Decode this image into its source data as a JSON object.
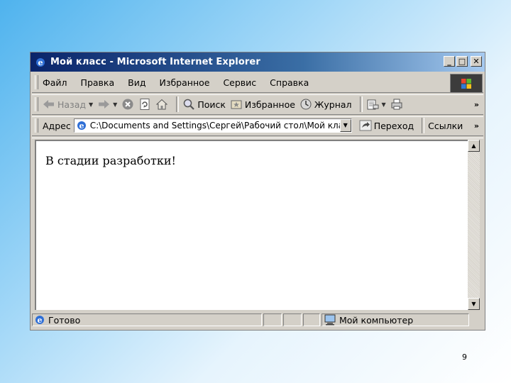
{
  "window": {
    "title": "Мой класс - Microsoft Internet Explorer"
  },
  "menu": {
    "items": [
      "Файл",
      "Правка",
      "Вид",
      "Избранное",
      "Сервис",
      "Справка"
    ]
  },
  "toolbar": {
    "back_label": "Назад",
    "search_label": "Поиск",
    "favorites_label": "Избранное",
    "history_label": "Журнал"
  },
  "address": {
    "label": "Адрес",
    "value": "C:\\Documents and Settings\\Сергей\\Рабочий стол\\Мой класс",
    "go_label": "Переход",
    "links_label": "Ссылки"
  },
  "page": {
    "text": "В стадии разработки!"
  },
  "status": {
    "text": "Готово",
    "zone": "Мой компьютер"
  },
  "slide": {
    "page_number": "9"
  },
  "colors": {
    "titlebar_start": "#0a246a",
    "titlebar_end": "#a6caf0",
    "chrome": "#d4d0c8"
  },
  "icons": [
    "ie-icon",
    "back-arrow-icon",
    "forward-arrow-icon",
    "stop-icon",
    "refresh-icon",
    "home-icon",
    "search-icon",
    "favorites-icon",
    "history-icon",
    "mail-icon",
    "print-icon",
    "go-arrow-icon",
    "windows-flag-icon",
    "computer-icon"
  ]
}
